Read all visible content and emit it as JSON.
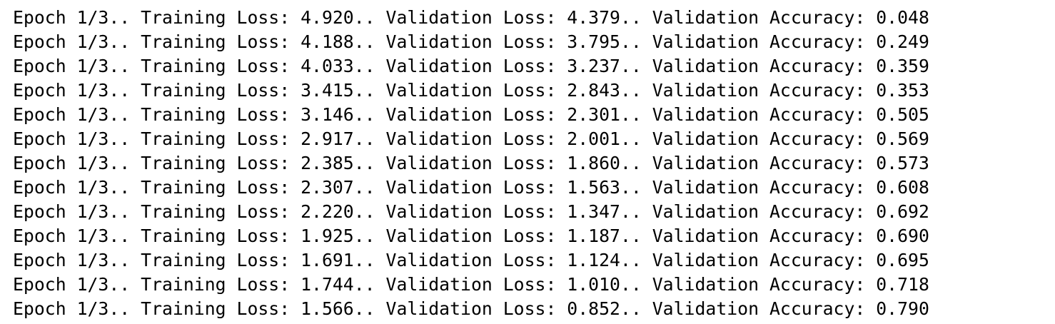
{
  "log": {
    "lines": [
      "Epoch 1/3.. Training Loss: 4.920.. Validation Loss: 4.379.. Validation Accuracy: 0.048",
      "Epoch 1/3.. Training Loss: 4.188.. Validation Loss: 3.795.. Validation Accuracy: 0.249",
      "Epoch 1/3.. Training Loss: 4.033.. Validation Loss: 3.237.. Validation Accuracy: 0.359",
      "Epoch 1/3.. Training Loss: 3.415.. Validation Loss: 2.843.. Validation Accuracy: 0.353",
      "Epoch 1/3.. Training Loss: 3.146.. Validation Loss: 2.301.. Validation Accuracy: 0.505",
      "Epoch 1/3.. Training Loss: 2.917.. Validation Loss: 2.001.. Validation Accuracy: 0.569",
      "Epoch 1/3.. Training Loss: 2.385.. Validation Loss: 1.860.. Validation Accuracy: 0.573",
      "Epoch 1/3.. Training Loss: 2.307.. Validation Loss: 1.563.. Validation Accuracy: 0.608",
      "Epoch 1/3.. Training Loss: 2.220.. Validation Loss: 1.347.. Validation Accuracy: 0.692",
      "Epoch 1/3.. Training Loss: 1.925.. Validation Loss: 1.187.. Validation Accuracy: 0.690",
      "Epoch 1/3.. Training Loss: 1.691.. Validation Loss: 1.124.. Validation Accuracy: 0.695",
      "Epoch 1/3.. Training Loss: 1.744.. Validation Loss: 1.010.. Validation Accuracy: 0.718",
      "Epoch 1/3.. Training Loss: 1.566.. Validation Loss: 0.852.. Validation Accuracy: 0.790"
    ]
  },
  "colors": {
    "background": "#ffffff",
    "text": "#000000"
  }
}
